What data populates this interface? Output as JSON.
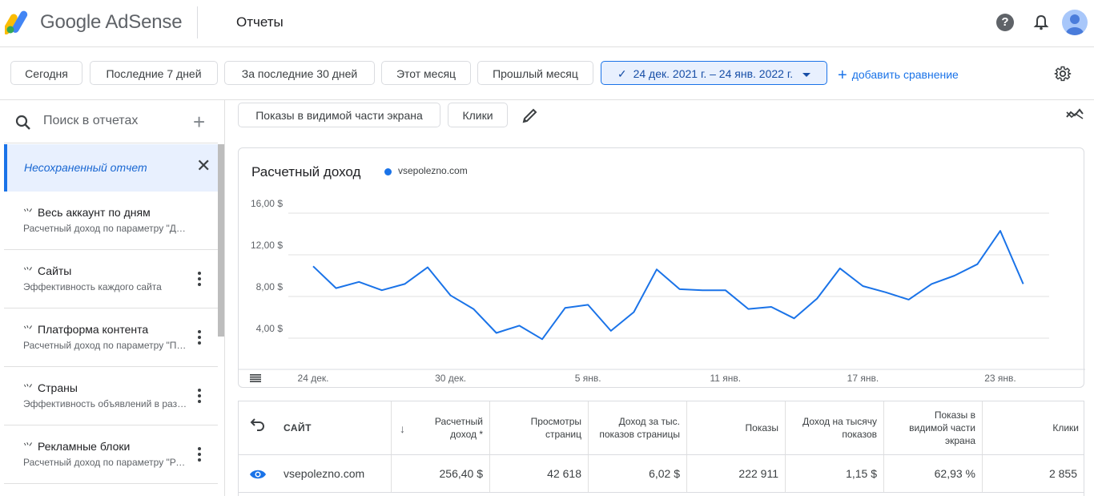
{
  "header": {
    "brand": "Google AdSense",
    "page_title": "Отчеты",
    "icons": [
      "help-icon",
      "bell-icon",
      "avatar"
    ]
  },
  "date_range": {
    "chips": [
      "Сегодня",
      "Последние 7 дней",
      "За последние 30 дней",
      "Этот месяц",
      "Прошлый месяц"
    ],
    "selected": "24 дек. 2021 г. – 24 янв. 2022 г.",
    "add_comparison": "добавить сравнение"
  },
  "sidebar": {
    "search_placeholder": "Поиск в отчетах",
    "unsaved": "Несохраненный отчет",
    "items": [
      {
        "title": "Весь аккаунт по дням",
        "subtitle": "Расчетный доход по параметру \"Дата\""
      },
      {
        "title": "Сайты",
        "subtitle": "Эффективность каждого сайта"
      },
      {
        "title": "Платформа контента",
        "subtitle": "Расчетный доход по параметру \"Платформа контента\""
      },
      {
        "title": "Страны",
        "subtitle": "Эффективность объявлений в разных странах"
      },
      {
        "title": "Рекламные блоки",
        "subtitle": "Расчетный доход по параметру \"Рекламный блок\""
      }
    ]
  },
  "metrics": {
    "chips": [
      "Показы в видимой части экрана",
      "Клики"
    ]
  },
  "chart_data": {
    "type": "line",
    "title": "Расчетный доход",
    "series": [
      {
        "name": "vsepolezno.com",
        "color": "#1a73e8",
        "values": [
          10.9,
          8.8,
          9.4,
          8.6,
          9.2,
          10.8,
          8.1,
          6.8,
          4.5,
          5.2,
          3.9,
          6.9,
          7.2,
          4.7,
          6.5,
          10.6,
          8.7,
          8.6,
          8.6,
          6.8,
          7.0,
          5.9,
          7.8,
          10.7,
          9.0,
          8.4,
          7.7,
          9.2,
          10.0,
          11.1,
          14.3,
          9.2
        ]
      }
    ],
    "y_ticks": [
      "4,00 $",
      "8,00 $",
      "12,00 $",
      "16,00 $"
    ],
    "y_tick_values": [
      4,
      8,
      12,
      16
    ],
    "ylim": [
      0,
      18
    ],
    "x_ticks": [
      {
        "label": "24 дек.",
        "index": 0
      },
      {
        "label": "30 дек.",
        "index": 6
      },
      {
        "label": "5 янв.",
        "index": 12
      },
      {
        "label": "11 янв.",
        "index": 18
      },
      {
        "label": "17 янв.",
        "index": 24
      },
      {
        "label": "23 янв.",
        "index": 30
      }
    ],
    "grid": true
  },
  "table": {
    "columns": [
      "САЙТ",
      "Расчетный доход *",
      "Просмотры страниц",
      "Доход за тыс. показов страницы",
      "Показы",
      "Доход на тысячу показов",
      "Показы в видимой части экрана",
      "Клики"
    ],
    "rows": [
      [
        "vsepolezno.com",
        "256,40 $",
        "42 618",
        "6,02 $",
        "222 911",
        "1,15 $",
        "62,93 %",
        "2 855"
      ]
    ]
  }
}
